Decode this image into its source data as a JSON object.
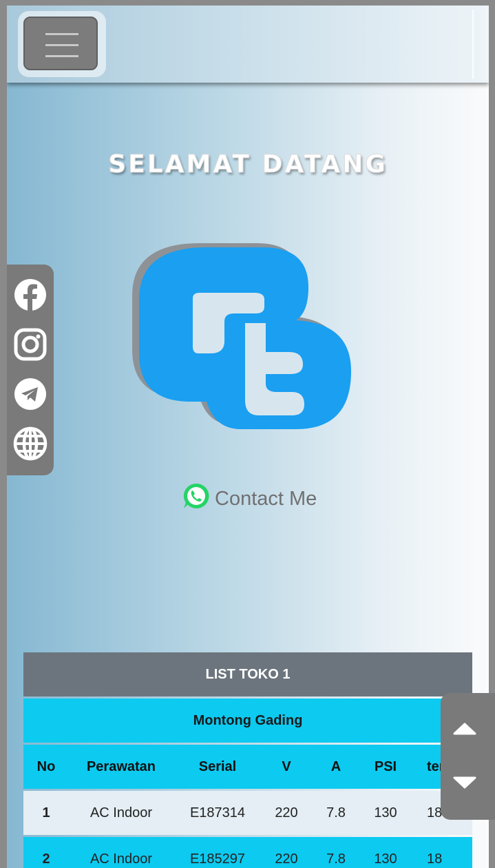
{
  "navbar": {
    "menu_icon": "hamburger-icon"
  },
  "hero": {
    "title": "SELAMAT DATANG"
  },
  "logo": {
    "icon": "gt-logo",
    "color": "#1a9ff1",
    "shadow": "#8e9296"
  },
  "social": [
    {
      "icon": "facebook-icon"
    },
    {
      "icon": "instagram-icon"
    },
    {
      "icon": "telegram-icon"
    },
    {
      "icon": "globe-icon"
    }
  ],
  "contact": {
    "icon": "whatsapp-icon",
    "label": "Contact Me",
    "icon_color": "#25d366"
  },
  "table": {
    "title": "LIST TOKO 1",
    "location": "Montong Gading",
    "headers": [
      "No",
      "Perawatan",
      "Serial",
      "V",
      "A",
      "PSI",
      "ter"
    ],
    "rows": [
      [
        "1",
        "AC Indoor",
        "E187314",
        "220",
        "7.8",
        "130",
        "18"
      ],
      [
        "2",
        "AC Indoor",
        "E185297",
        "220",
        "7.8",
        "130",
        "18"
      ]
    ]
  },
  "scroll_controls": {
    "up_icon": "caret-up-icon",
    "down_icon": "caret-down-icon"
  },
  "colors": {
    "header": "#6c757d",
    "accent": "#0dcaf0",
    "panel": "#7a7a7a"
  }
}
